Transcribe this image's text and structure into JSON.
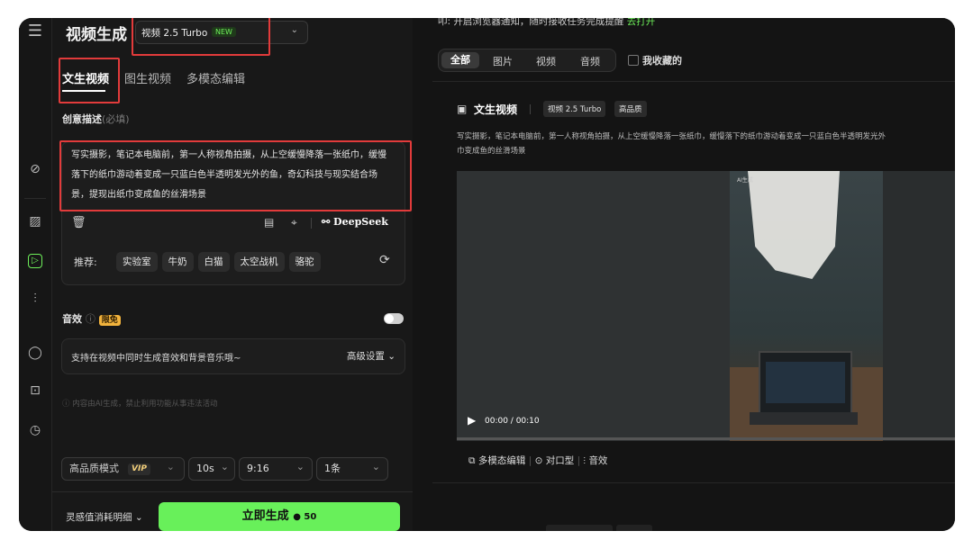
{
  "header": {
    "title": "视频生成",
    "model": "视频 2.5 Turbo",
    "model_badge": "NEW"
  },
  "tabs": [
    {
      "label": "文生视频",
      "active": true
    },
    {
      "label": "图生视频",
      "active": false
    },
    {
      "label": "多模态编辑",
      "active": false
    }
  ],
  "prompt": {
    "label": "创意描述",
    "required_note": "(必填)",
    "lines": [
      "写实摄影，笔记本电脑前，第一人称视角拍摄，从上空缓慢降落一张纸巾，缓慢",
      "落下的纸巾游动着变成一只蓝白色半透明发光外的鱼，奇幻科技与现实结合场",
      "景，提现出纸巾变成鱼的丝滑场景"
    ],
    "deepseek_label": "DeepSeek"
  },
  "recommend": {
    "label": "推荐:",
    "items": [
      "实验室",
      "牛奶",
      "白猫",
      "太空战机",
      "骆驼"
    ]
  },
  "sound": {
    "label": "音效",
    "info": "ⓘ",
    "badge": "限免",
    "desc": "支持在视频中同时生成音效和背景音乐哦~",
    "advanced": "高级设置"
  },
  "disclaimer": "ⓘ 内容由AI生成，禁止利用功能从事违法活动",
  "settings": {
    "quality": "高品质模式",
    "quality_badge": "VIP",
    "duration": "10s",
    "ratio": "9:16",
    "count": "1条"
  },
  "footer": {
    "credits_detail": "灵感值消耗明细",
    "generate": "立即生成",
    "cost": "50"
  },
  "right": {
    "notice": "叩: 开启浏览器通知，随时接收任务完成提醒",
    "notice_link": "去打开",
    "filters": [
      {
        "label": "全部",
        "active": true
      },
      {
        "label": "图片",
        "active": false
      },
      {
        "label": "视频",
        "active": false
      },
      {
        "label": "音频",
        "active": false
      }
    ],
    "favorites": "我收藏的",
    "card": {
      "title": "文生视频",
      "tag_model": "视频 2.5 Turbo",
      "tag_quality": "高品质",
      "desc_line1": "写实摄影，笔记本电脑前，第一人称视角拍摄，从上空缓慢降落一张纸巾，缓慢落下的纸巾游动着变成一只蓝白色半透明发光外",
      "desc_line2": "巾变成鱼的丝滑场景",
      "watermark": "AI生成",
      "time": "00:00 / 00:10",
      "actions": [
        "多模态编辑",
        "对口型",
        "音效"
      ]
    }
  }
}
